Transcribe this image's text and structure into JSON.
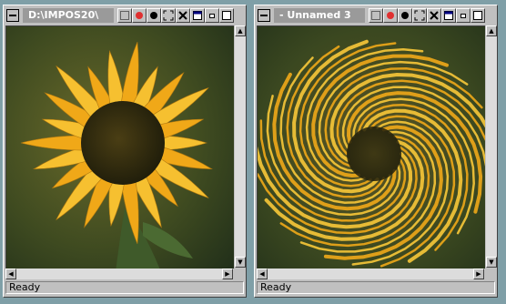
{
  "windows": [
    {
      "title": "D:\\IMPOS20\\",
      "status": "Ready",
      "image": "sunflower-original"
    },
    {
      "title": "-  Unnamed  3",
      "status": "Ready",
      "image": "sunflower-swirl"
    }
  ],
  "toolbar_icons": [
    "select-dotted-icon",
    "record-red-icon",
    "record-black-icon",
    "crop-icon",
    "tools-icon",
    "window-icon",
    "minimize-icon",
    "restore-icon"
  ],
  "colors": {
    "desktop": "#7f9fa7",
    "chrome": "#c0c0c0",
    "title_bg": "#9a9a9a",
    "petal": "#f0a818",
    "center": "#2c2a10"
  }
}
